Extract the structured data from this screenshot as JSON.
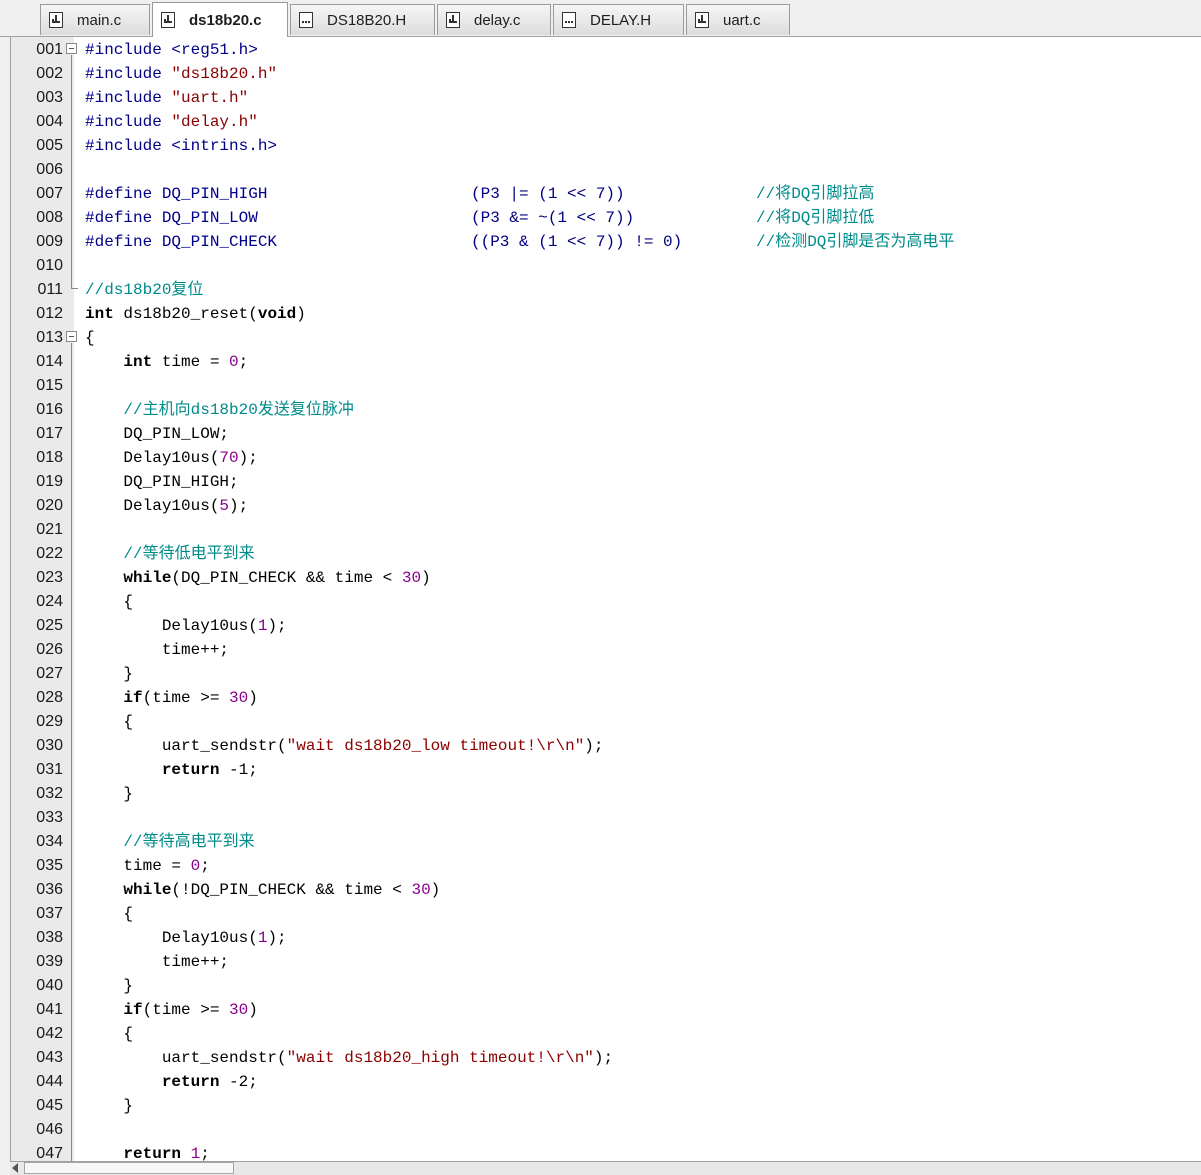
{
  "tabs": [
    {
      "label": "main.c",
      "type": "c",
      "active": false
    },
    {
      "label": "ds18b20.c",
      "type": "c",
      "active": true
    },
    {
      "label": "DS18B20.H",
      "type": "h",
      "active": false
    },
    {
      "label": "delay.c",
      "type": "c",
      "active": false
    },
    {
      "label": "DELAY.H",
      "type": "h",
      "active": false
    },
    {
      "label": "uart.c",
      "type": "c",
      "active": false
    }
  ],
  "line_numbers": [
    "001",
    "002",
    "003",
    "004",
    "005",
    "006",
    "007",
    "008",
    "009",
    "010",
    "011",
    "012",
    "013",
    "014",
    "015",
    "016",
    "017",
    "018",
    "019",
    "020",
    "021",
    "022",
    "023",
    "024",
    "025",
    "026",
    "027",
    "028",
    "029",
    "030",
    "031",
    "032",
    "033",
    "034",
    "035",
    "036",
    "037",
    "038",
    "039",
    "040",
    "041",
    "042",
    "043",
    "044",
    "045",
    "046",
    "047"
  ],
  "code": {
    "l1": "#include <reg51.h>",
    "l2a": "#include ",
    "l2b": "\"ds18b20.h\"",
    "l3a": "#include ",
    "l3b": "\"uart.h\"",
    "l4a": "#include ",
    "l4b": "\"delay.h\"",
    "l5": "#include <intrins.h>",
    "l7a": "#define DQ_PIN_HIGH",
    "l7b": "(P3 |= (1 << 7))",
    "l7c": "//将DQ引脚拉高",
    "l8a": "#define DQ_PIN_LOW",
    "l8b": "(P3 &= ~(1 << 7))",
    "l8c": "//将DQ引脚拉低",
    "l9a": "#define DQ_PIN_CHECK",
    "l9b": "((P3 & (1 << 7)) != 0)",
    "l9c": "//检测DQ引脚是否为高电平",
    "l11": "//ds18b20复位",
    "l12a": "int",
    "l12b": " ds18b20_reset(",
    "l12c": "void",
    "l12d": ")",
    "l13": "{",
    "l14a": "    ",
    "l14b": "int",
    "l14c": " time = ",
    "l14d": "0",
    "l14e": ";",
    "l16": "    //主机向ds18b20发送复位脉冲",
    "l17": "    DQ_PIN_LOW;",
    "l18a": "    Delay10us(",
    "l18b": "70",
    "l18c": ");",
    "l19": "    DQ_PIN_HIGH;",
    "l20a": "    Delay10us(",
    "l20b": "5",
    "l20c": ");",
    "l22": "    //等待低电平到来",
    "l23a": "    ",
    "l23b": "while",
    "l23c": "(DQ_PIN_CHECK && time < ",
    "l23d": "30",
    "l23e": ")",
    "l24": "    {",
    "l25a": "        Delay10us(",
    "l25b": "1",
    "l25c": ");",
    "l26": "        time++;",
    "l27": "    }",
    "l28a": "    ",
    "l28b": "if",
    "l28c": "(time >= ",
    "l28d": "30",
    "l28e": ")",
    "l29": "    {",
    "l30a": "        uart_sendstr(",
    "l30b": "\"wait ds18b20_low timeout!\\r\\n\"",
    "l30c": ");",
    "l31a": "        ",
    "l31b": "return",
    "l31c": " -1;",
    "l32": "    }",
    "l34": "    //等待高电平到来",
    "l35a": "    time = ",
    "l35b": "0",
    "l35c": ";",
    "l36a": "    ",
    "l36b": "while",
    "l36c": "(!DQ_PIN_CHECK && time < ",
    "l36d": "30",
    "l36e": ")",
    "l37": "    {",
    "l38a": "        Delay10us(",
    "l38b": "1",
    "l38c": ");",
    "l39": "        time++;",
    "l40": "    }",
    "l41a": "    ",
    "l41b": "if",
    "l41c": "(time >= ",
    "l41d": "30",
    "l41e": ")",
    "l42": "    {",
    "l43a": "        uart_sendstr(",
    "l43b": "\"wait ds18b20_high timeout!\\r\\n\"",
    "l43c": ");",
    "l44a": "        ",
    "l44b": "return",
    "l44c": " -2;",
    "l45": "    }",
    "l47a": "    ",
    "l47b": "return",
    "l47c": " ",
    "l47d": "1",
    "l47e": ";"
  }
}
